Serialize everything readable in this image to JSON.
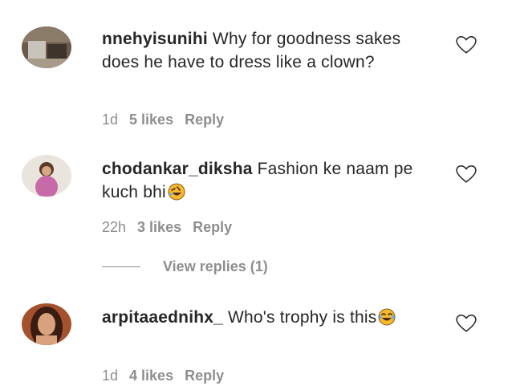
{
  "comments": [
    {
      "username": "nnehyisunihi",
      "text": "Why for goodness sakes does he have to dress like a clown?",
      "emoji": "",
      "time": "1d",
      "likes": "5 likes",
      "reply": "Reply"
    },
    {
      "username": "chodankar_diksha",
      "text": "Fashion ke naam pe kuch bhi",
      "emoji": "rolling-on-floor-laughing-icon",
      "time": "22h",
      "likes": "3 likes",
      "reply": "Reply"
    },
    {
      "username": "arpitaaednihx_",
      "text": "Who's trophy is this",
      "emoji": "tears-of-joy-icon",
      "time": "1d",
      "likes": "4 likes",
      "reply": "Reply"
    }
  ],
  "view_replies": "View replies (1)",
  "colors": {
    "text": "#262626",
    "meta": "#8e8e8e",
    "emoji": "#f5b82e"
  }
}
